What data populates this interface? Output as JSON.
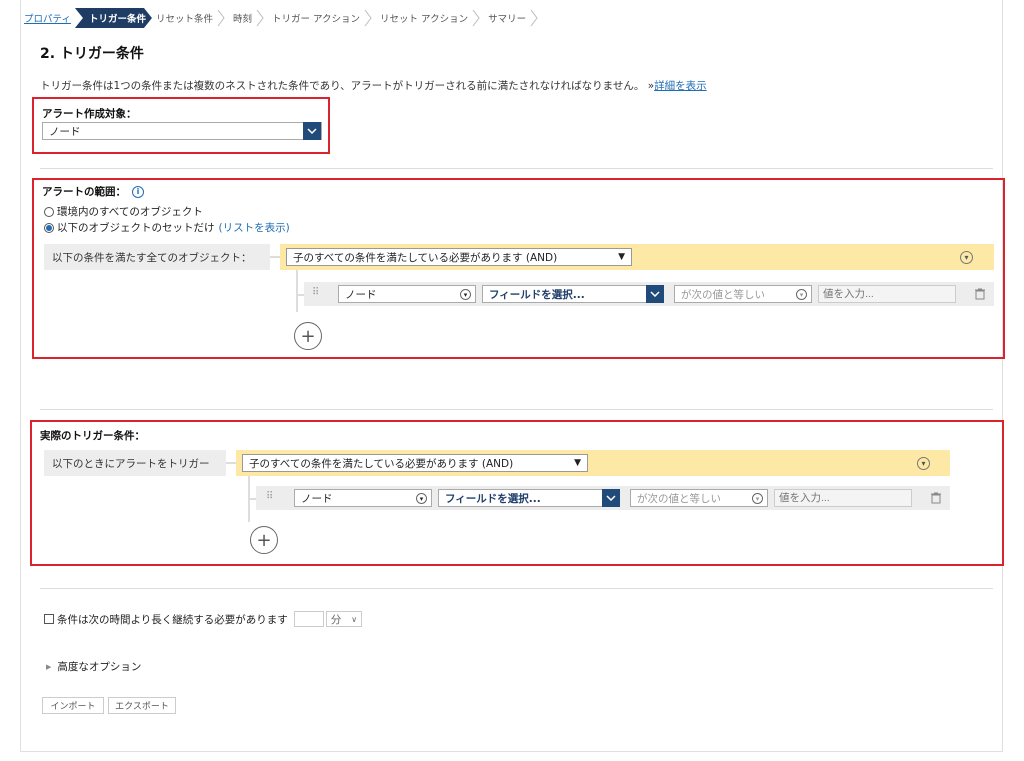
{
  "breadcrumb": [
    {
      "label": "プロパティ",
      "state": "link"
    },
    {
      "label": "トリガー条件",
      "state": "active"
    },
    {
      "label": "リセット条件",
      "state": "inactive"
    },
    {
      "label": "時刻",
      "state": "inactive"
    },
    {
      "label": "トリガー アクション",
      "state": "inactive"
    },
    {
      "label": "リセット アクション",
      "state": "inactive"
    },
    {
      "label": "サマリー",
      "state": "inactive"
    }
  ],
  "page": {
    "title": "2. トリガー条件",
    "description": "トリガー条件は1つの条件または複数のネストされた条件であり、アラートがトリガーされる前に満たされなければなりません。",
    "more_prefix": "»",
    "more_link": "詳細を表示"
  },
  "target": {
    "label": "アラート作成対象：",
    "value": "ノード"
  },
  "scope": {
    "label": "アラートの範囲：",
    "info_icon": "info-icon",
    "option_all": "環境内のすべてのオブジェクト",
    "option_subset": "以下のオブジェクトのセットだけ",
    "list_link": "(リストを表示)",
    "selected": "option_subset",
    "condition_label": "以下の条件を満たす全てのオブジェクト：",
    "and_select": "子のすべての条件を満たしている必要があります (AND)",
    "row": {
      "object": "ノード",
      "field": "フィールドを選択...",
      "operator": "が次の値と等しい",
      "value_placeholder": "値を入力..."
    }
  },
  "trigger": {
    "label": "実際のトリガー条件：",
    "condition_label": "以下のときにアラートをトリガー",
    "and_select": "子のすべての条件を満たしている必要があります (AND)",
    "row": {
      "object": "ノード",
      "field": "フィールドを選択...",
      "operator": "が次の値と等しい",
      "value_placeholder": "値を入力..."
    }
  },
  "duration": {
    "label": "条件は次の時間より長く継続する必要があります",
    "value": "",
    "unit": "分"
  },
  "advanced": {
    "label": "高度なオプション"
  },
  "buttons": {
    "import": "インポート",
    "export": "エクスポート"
  },
  "colors": {
    "accent": "#1e3c64",
    "highlight": "#d9232d",
    "group": "#fde8a6",
    "link": "#1f6db5"
  }
}
